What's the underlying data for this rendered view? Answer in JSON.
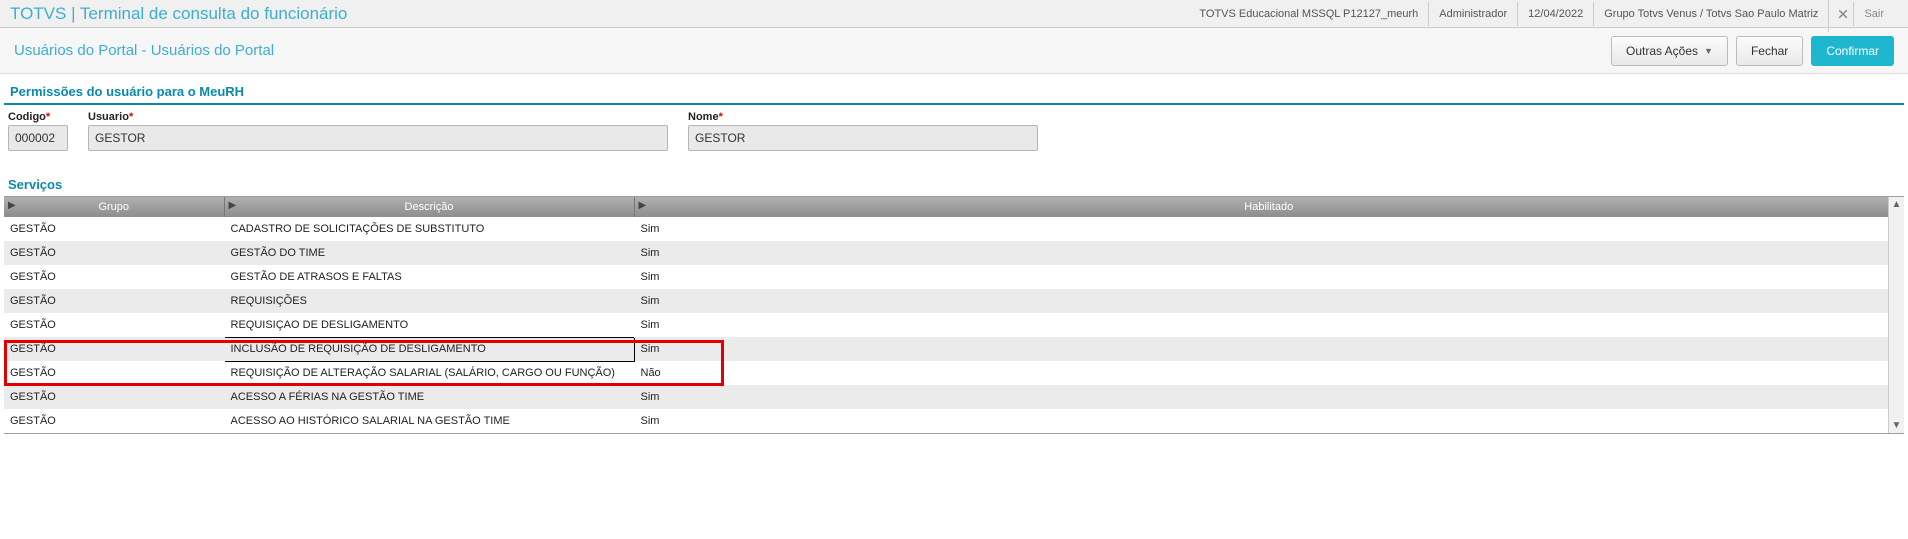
{
  "app": {
    "brand": "TOTVS",
    "title": "Terminal de consulta do funcionário"
  },
  "topright": {
    "context": "TOTVS Educacional MSSQL P12127_meurh",
    "user": "Administrador",
    "date": "12/04/2022",
    "company": "Grupo Totvs Venus / Totvs Sao Paulo Matriz",
    "exit": "Sair"
  },
  "breadcrumb": "Usuários do Portal - Usuários do Portal",
  "buttons": {
    "other": "Outras Ações",
    "close": "Fechar",
    "confirm": "Confirmar"
  },
  "section_permissions": "Permissões do usuário para o MeuRH",
  "form": {
    "codigo_label": "Codigo",
    "codigo_value": "000002",
    "usuario_label": "Usuario",
    "usuario_value": "GESTOR",
    "nome_label": "Nome",
    "nome_value": "GESTOR"
  },
  "section_services": "Serviços",
  "columns": {
    "grupo": "Grupo",
    "descricao": "Descrição",
    "habilitado": "Habilitado"
  },
  "rows": [
    {
      "grupo": "GESTÃO",
      "descricao": "CADASTRO DE SOLICITAÇÕES DE SUBSTITUTO",
      "habilitado": "Sim"
    },
    {
      "grupo": "GESTÃO",
      "descricao": "GESTÃO DO TIME",
      "habilitado": "Sim"
    },
    {
      "grupo": "GESTÃO",
      "descricao": "GESTÃO DE ATRASOS E FALTAS",
      "habilitado": "Sim"
    },
    {
      "grupo": "GESTÃO",
      "descricao": "REQUISIÇÕES",
      "habilitado": "Sim"
    },
    {
      "grupo": "GESTÃO",
      "descricao": "REQUISIÇAO DE DESLIGAMENTO",
      "habilitado": "Sim"
    },
    {
      "grupo": "GESTÃO",
      "descricao": "INCLUSÃO DE REQUISIÇÃO DE DESLIGAMENTO",
      "habilitado": "Sim"
    },
    {
      "grupo": "GESTÃO",
      "descricao": "REQUISIÇÃO DE ALTERAÇÃO SALARIAL (SALÁRIO, CARGO OU FUNÇÃO)",
      "habilitado": "Não"
    },
    {
      "grupo": "GESTÃO",
      "descricao": "ACESSO A FÉRIAS NA GESTÃO TIME",
      "habilitado": "Sim"
    },
    {
      "grupo": "GESTÃO",
      "descricao": "ACESSO AO HISTÓRICO SALARIAL NA GESTÃO TIME",
      "habilitado": "Sim"
    }
  ]
}
